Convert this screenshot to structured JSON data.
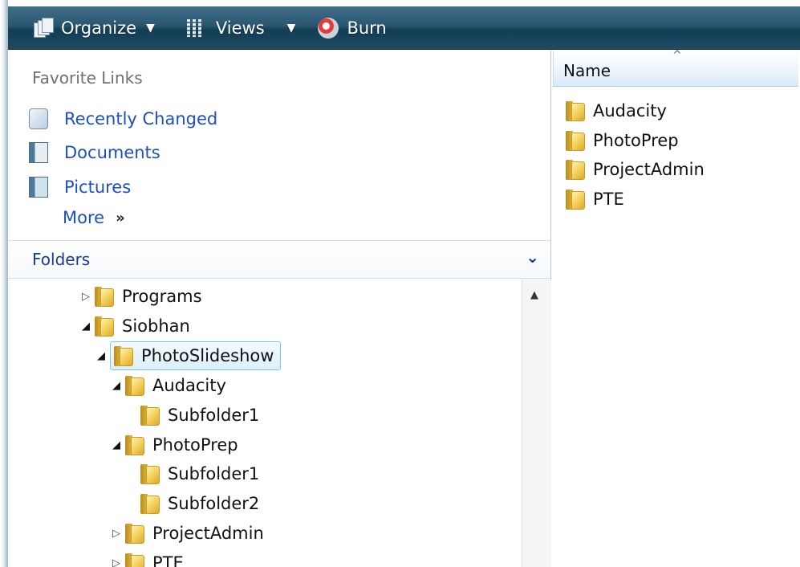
{
  "toolbar": {
    "organize_label": "Organize",
    "views_label": "Views",
    "burn_label": "Burn",
    "caret": "▼"
  },
  "favorites": {
    "title": "Favorite Links",
    "links": [
      {
        "label": "Recently Changed",
        "icon": "recently-changed-icon"
      },
      {
        "label": "Documents",
        "icon": "documents-icon"
      },
      {
        "label": "Pictures",
        "icon": "pictures-icon"
      }
    ],
    "more_label": "More",
    "more_chevron": "»"
  },
  "folders": {
    "title": "Folders",
    "collapse_glyph": "⌄",
    "tree": [
      {
        "label": "Programs",
        "expander": "▷",
        "depth": 0
      },
      {
        "label": "Siobhan",
        "expander": "◢",
        "depth": 0
      },
      {
        "label": "PhotoSlideshow",
        "expander": "◢",
        "depth": 1,
        "selected": true
      },
      {
        "label": "Audacity",
        "expander": "◢",
        "depth": 2
      },
      {
        "label": "Subfolder1",
        "expander": "",
        "depth": 3
      },
      {
        "label": "PhotoPrep",
        "expander": "◢",
        "depth": 2
      },
      {
        "label": "Subfolder1",
        "expander": "",
        "depth": 3
      },
      {
        "label": "Subfolder2",
        "expander": "",
        "depth": 3
      },
      {
        "label": "ProjectAdmin",
        "expander": "▷",
        "depth": 2
      },
      {
        "label": "PTE",
        "expander": "▷",
        "depth": 2
      }
    ]
  },
  "content": {
    "column_header": "Name",
    "sort_glyph": "^",
    "items": [
      "Audacity",
      "PhotoPrep",
      "ProjectAdmin",
      "PTE"
    ]
  },
  "colors": {
    "toolbar": "#2a5670",
    "link": "#1d4fc4",
    "selection_border": "#7fc4ee",
    "folder": "#f6d463"
  }
}
